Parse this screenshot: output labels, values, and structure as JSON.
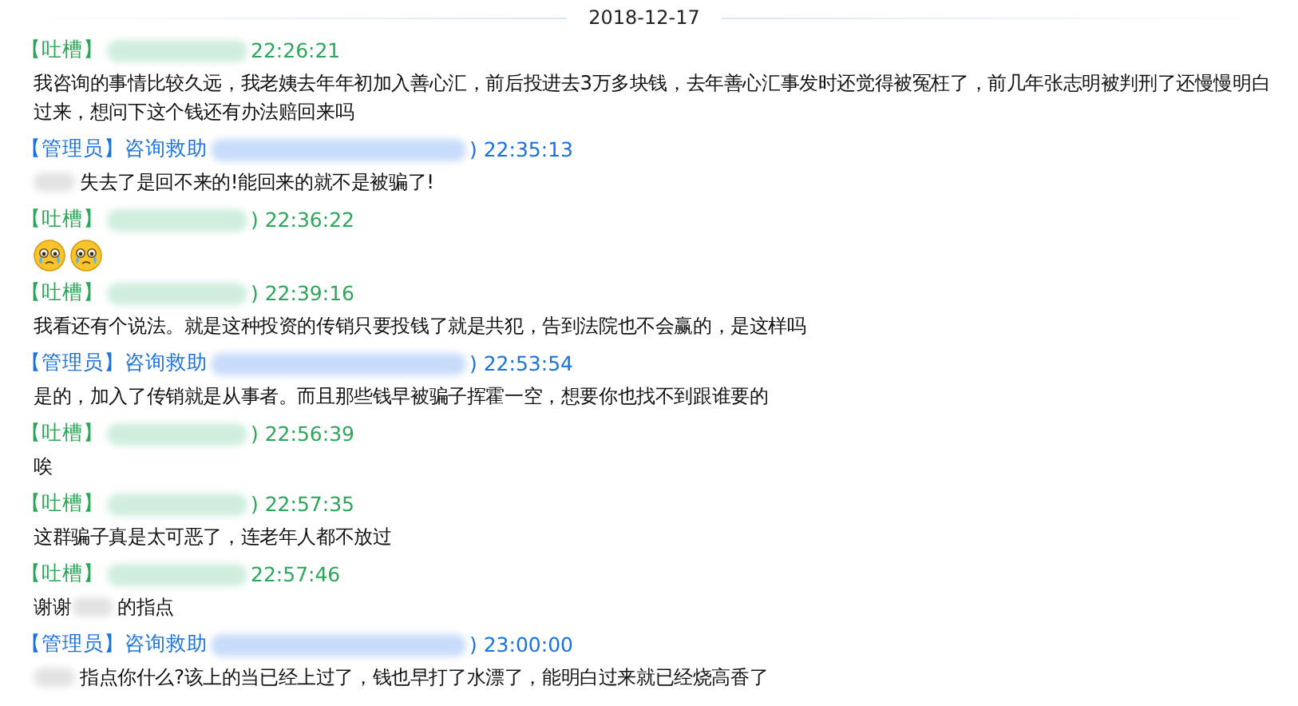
{
  "date_divider": "2018-12-17",
  "messages": [
    {
      "kind": "member",
      "role": "【吐槽】",
      "name_hidden": true,
      "time": "22:26:21",
      "body": [
        {
          "kind": "text",
          "text": "我咨询的事情比较久远，我老姨去年年初加入善心汇，前后投进去3万多块钱，去年善心汇事发时还觉得被冤枉了，前几年张志明被判刑了还慢慢明白过来，想问下这个钱还有办法赔回来吗"
        }
      ]
    },
    {
      "kind": "admin",
      "role": "【管理员】",
      "prefix": "咨询救助",
      "name_hidden": true,
      "time": ") 22:35:13",
      "body": [
        {
          "kind": "blur"
        },
        {
          "kind": "text",
          "text": "失去了是回不来的!能回来的就不是被骗了!"
        }
      ]
    },
    {
      "kind": "member",
      "role": "【吐槽】",
      "name_hidden": true,
      "time": ") 22:36:22",
      "body": [
        {
          "kind": "emoji"
        },
        {
          "kind": "emoji"
        }
      ]
    },
    {
      "kind": "member",
      "role": "【吐槽】",
      "name_hidden": true,
      "time": ") 22:39:16",
      "body": [
        {
          "kind": "text",
          "text": "我看还有个说法。就是这种投资的传销只要投钱了就是共犯，告到法院也不会赢的，是这样吗"
        }
      ]
    },
    {
      "kind": "admin",
      "role": "【管理员】",
      "prefix": "咨询救助",
      "name_hidden": true,
      "time": ") 22:53:54",
      "body": [
        {
          "kind": "text",
          "text": "是的，加入了传销就是从事者。而且那些钱早被骗子挥霍一空，想要你也找不到跟谁要的"
        }
      ]
    },
    {
      "kind": "member",
      "role": "【吐槽】",
      "name_hidden": true,
      "time": ") 22:56:39",
      "body": [
        {
          "kind": "text",
          "text": "唉"
        }
      ]
    },
    {
      "kind": "member",
      "role": "【吐槽】",
      "name_hidden": true,
      "time": ") 22:57:35",
      "body": [
        {
          "kind": "text",
          "text": "这群骗子真是太可恶了，连老年人都不放过"
        }
      ]
    },
    {
      "kind": "member",
      "role": "【吐槽】",
      "name_hidden": true,
      "time": "22:57:46",
      "body": [
        {
          "kind": "text",
          "text": "谢谢"
        },
        {
          "kind": "blur"
        },
        {
          "kind": "text",
          "text": "的指点"
        }
      ]
    },
    {
      "kind": "admin",
      "role": "【管理员】",
      "prefix": "咨询救助",
      "name_hidden": true,
      "time": ") 23:00:00",
      "body": [
        {
          "kind": "blur"
        },
        {
          "kind": "text",
          "text": "指点你什么?该上的当已经上过了，钱也早打了水漂了，能明白过来就已经烧高香了"
        }
      ]
    }
  ]
}
